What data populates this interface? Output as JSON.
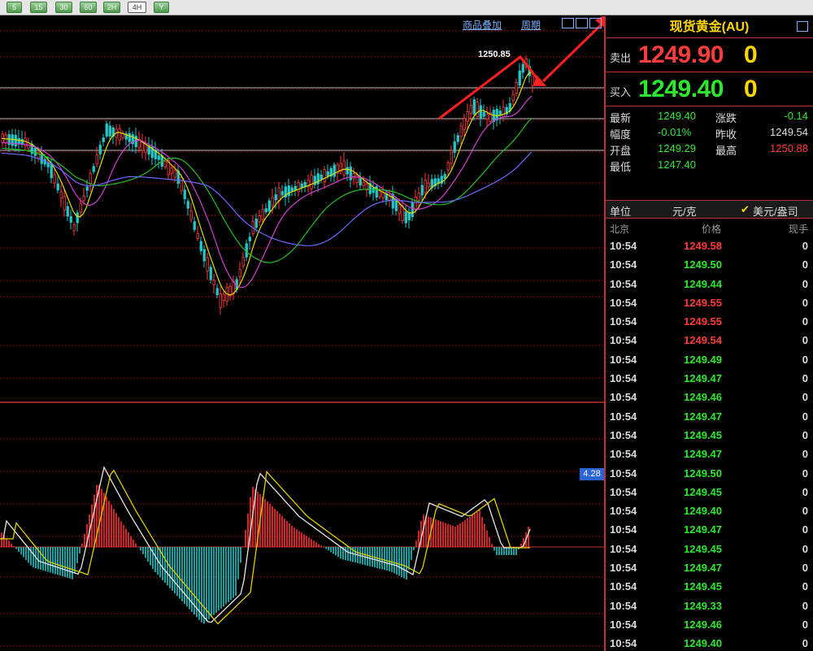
{
  "toolbar": {
    "buttons": [
      {
        "label": "5",
        "active": false
      },
      {
        "label": "15",
        "active": false
      },
      {
        "label": "30",
        "active": false
      },
      {
        "label": "60",
        "active": false
      },
      {
        "label": "2H",
        "active": false
      },
      {
        "label": "4H",
        "active": true
      },
      {
        "label": "Y",
        "active": false
      }
    ]
  },
  "chart": {
    "overlay_link": "商品叠加",
    "period_link": "周期",
    "peak_label": "1250.85",
    "macd_value": "4.28"
  },
  "panel": {
    "title": "现货黄金(AU)",
    "sell_label": "卖出",
    "sell_price": "1249.90",
    "sell_vol": "0",
    "buy_label": "买入",
    "buy_price": "1249.40",
    "buy_vol": "0",
    "stats": {
      "latest_label": "最新",
      "latest": "1249.40",
      "change_label": "涨跌",
      "change": "-0.14",
      "amp_label": "幅度",
      "amp": "-0.01%",
      "prev_label": "昨收",
      "prev": "1249.54",
      "open_label": "开盘",
      "open": "1249.29",
      "high_label": "最高",
      "high": "1250.88",
      "low_label": "最低",
      "low": "1247.40"
    },
    "unit": {
      "label": "单位",
      "value": "元/克",
      "alt": "美元/盎司"
    },
    "tick_header": {
      "time": "北京",
      "price": "价格",
      "vol": "现手"
    },
    "ticks": [
      {
        "time": "10:54",
        "price": "1249.58",
        "dir": "up",
        "vol": "0"
      },
      {
        "time": "10:54",
        "price": "1249.50",
        "dir": "down",
        "vol": "0"
      },
      {
        "time": "10:54",
        "price": "1249.44",
        "dir": "down",
        "vol": "0"
      },
      {
        "time": "10:54",
        "price": "1249.55",
        "dir": "up",
        "vol": "0"
      },
      {
        "time": "10:54",
        "price": "1249.55",
        "dir": "up",
        "vol": "0"
      },
      {
        "time": "10:54",
        "price": "1249.54",
        "dir": "up",
        "vol": "0"
      },
      {
        "time": "10:54",
        "price": "1249.49",
        "dir": "down",
        "vol": "0"
      },
      {
        "time": "10:54",
        "price": "1249.47",
        "dir": "down",
        "vol": "0"
      },
      {
        "time": "10:54",
        "price": "1249.46",
        "dir": "down",
        "vol": "0"
      },
      {
        "time": "10:54",
        "price": "1249.47",
        "dir": "down",
        "vol": "0"
      },
      {
        "time": "10:54",
        "price": "1249.45",
        "dir": "down",
        "vol": "0"
      },
      {
        "time": "10:54",
        "price": "1249.47",
        "dir": "down",
        "vol": "0"
      },
      {
        "time": "10:54",
        "price": "1249.50",
        "dir": "down",
        "vol": "0"
      },
      {
        "time": "10:54",
        "price": "1249.45",
        "dir": "down",
        "vol": "0"
      },
      {
        "time": "10:54",
        "price": "1249.40",
        "dir": "down",
        "vol": "0"
      },
      {
        "time": "10:54",
        "price": "1249.47",
        "dir": "down",
        "vol": "0"
      },
      {
        "time": "10:54",
        "price": "1249.45",
        "dir": "down",
        "vol": "0"
      },
      {
        "time": "10:54",
        "price": "1249.47",
        "dir": "down",
        "vol": "0"
      },
      {
        "time": "10:54",
        "price": "1249.45",
        "dir": "down",
        "vol": "0"
      },
      {
        "time": "10:54",
        "price": "1249.33",
        "dir": "down",
        "vol": "0"
      },
      {
        "time": "10:54",
        "price": "1249.46",
        "dir": "down",
        "vol": "0"
      },
      {
        "time": "10:54",
        "price": "1249.40",
        "dir": "down",
        "vol": "0"
      }
    ]
  },
  "colors": {
    "up": "#ff3b3b",
    "down": "#2ee82e",
    "accent_gold": "#ffd700",
    "grid_red": "#8a1010",
    "annotation": "#ff2020"
  }
}
